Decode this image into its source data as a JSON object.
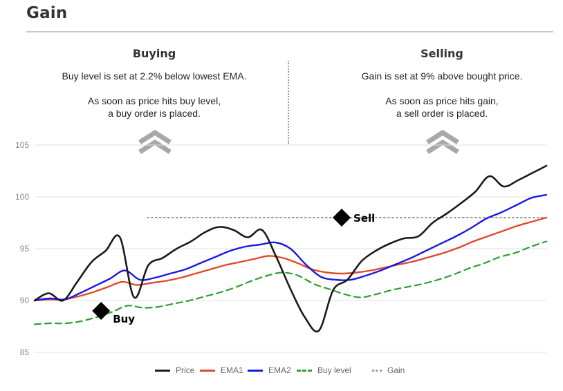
{
  "title": "Gain",
  "panels": {
    "buying": {
      "heading": "Buying",
      "line1": "Buy level is set at 2.2% below lowest EMA.",
      "line2a": "As soon as price hits buy level,",
      "line2b": "a buy order is placed."
    },
    "selling": {
      "heading": "Selling",
      "line1": "Gain is set at 9% above bought price.",
      "line2a": "As soon as price hits gain,",
      "line2b": "a sell order is placed."
    }
  },
  "colors": {
    "price": "#1a1a1a",
    "ema1": "#e04a2a",
    "ema2": "#1a1ae0",
    "buy_level": "#2e9e2e",
    "gain": "#999999",
    "chevron": "#a8a8a8",
    "grid": "#e2e2e2"
  },
  "icons": {
    "up_chevron": "double-chevron-up-icon",
    "marker": "diamond-marker-icon"
  },
  "chart_data": {
    "type": "line",
    "ylim": [
      85,
      105
    ],
    "yticks": [
      "85",
      "90",
      "95",
      "100",
      "105"
    ],
    "x": [
      0,
      1,
      2,
      3,
      4,
      5,
      6,
      7,
      8,
      9,
      10,
      11,
      12,
      13,
      14,
      15,
      16,
      17,
      18,
      19,
      20,
      21,
      22,
      23,
      24,
      25,
      26,
      27,
      28,
      29,
      30,
      31,
      32,
      33,
      34,
      35,
      36,
      37,
      38,
      39,
      40,
      41,
      42,
      43,
      44,
      45,
      46,
      47,
      48,
      49,
      50
    ],
    "series": [
      {
        "name": "Price",
        "key": "price",
        "dash": "",
        "width": 2.6,
        "values": [
          90.0,
          90.7,
          90.0,
          91.8,
          93.7,
          94.8,
          96.1,
          90.3,
          93.4,
          94.1,
          95.0,
          95.7,
          96.6,
          97.1,
          96.8,
          96.1,
          96.8,
          94.2,
          91.1,
          88.4,
          87.1,
          91.0,
          92.0,
          93.8,
          94.8,
          95.5,
          96.0,
          96.2,
          97.5,
          98.4,
          99.4,
          100.5,
          102.0,
          101.0,
          101.6,
          102.3,
          103.0
        ]
      },
      {
        "name": "EMA1",
        "key": "ema1",
        "dash": "",
        "width": 2.4,
        "values": [
          90.0,
          90.1,
          90.1,
          90.4,
          90.8,
          91.3,
          91.8,
          91.5,
          91.7,
          91.9,
          92.2,
          92.6,
          93.0,
          93.4,
          93.7,
          94.0,
          94.3,
          94.1,
          93.6,
          93.0,
          92.7,
          92.6,
          92.7,
          92.9,
          93.2,
          93.5,
          93.8,
          94.2,
          94.6,
          95.1,
          95.7,
          96.2,
          96.7,
          97.2,
          97.6,
          98.0
        ]
      },
      {
        "name": "EMA2",
        "key": "ema2",
        "dash": "",
        "width": 2.4,
        "values": [
          90.0,
          90.2,
          90.1,
          90.7,
          91.4,
          92.1,
          92.9,
          92.0,
          92.2,
          92.6,
          93.0,
          93.6,
          94.2,
          94.8,
          95.2,
          95.4,
          95.6,
          95.0,
          93.5,
          92.3,
          92.0,
          92.0,
          92.4,
          92.9,
          93.5,
          94.1,
          94.8,
          95.5,
          96.2,
          97.0,
          97.9,
          98.5,
          99.2,
          99.9,
          100.2
        ]
      },
      {
        "name": "Buy level",
        "key": "buy_level",
        "dash": "9 6",
        "width": 2.2,
        "values": [
          87.7,
          87.8,
          87.8,
          88.0,
          88.4,
          88.9,
          89.5,
          89.3,
          89.4,
          89.7,
          90.0,
          90.4,
          90.8,
          91.3,
          91.9,
          92.4,
          92.7,
          92.4,
          91.6,
          91.1,
          90.6,
          90.3,
          90.6,
          91.0,
          91.3,
          91.6,
          92.0,
          92.5,
          93.1,
          93.6,
          94.2,
          94.6,
          95.2,
          95.7
        ]
      },
      {
        "name": "Gain",
        "key": "gain",
        "dash": "2 4",
        "width": 2,
        "values": [
          98.0,
          98.0
        ]
      }
    ],
    "annotations": [
      {
        "label": "Buy",
        "x": 6.5,
        "y": 89.0
      },
      {
        "label": "Sell",
        "x": 30.0,
        "y": 98.0
      }
    ],
    "legend_position": "bottom-center",
    "grid": true
  }
}
